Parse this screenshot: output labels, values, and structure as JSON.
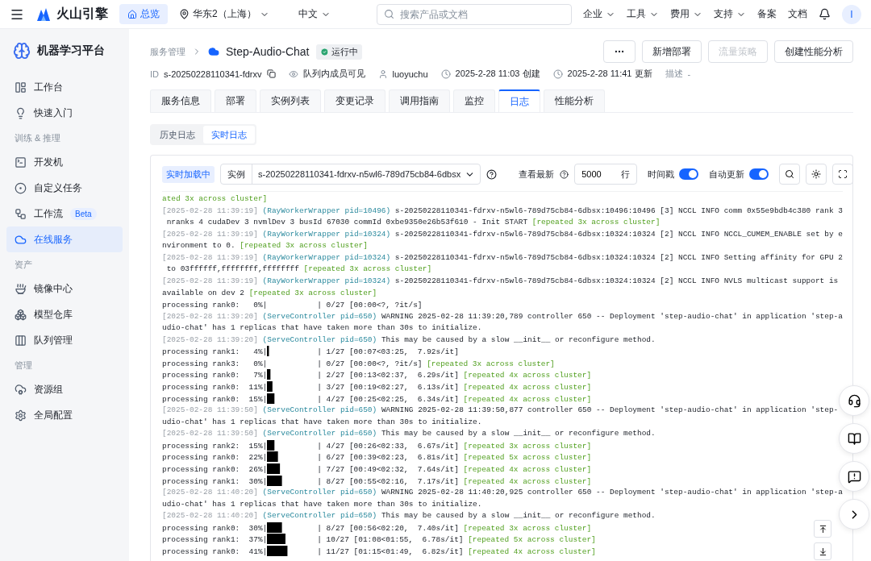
{
  "topbar": {
    "brand": "火山引擎",
    "home": "总览",
    "region": "华东2（上海）",
    "language": "中文",
    "search": {
      "placeholder": "搜索产品或文档"
    },
    "menus": [
      {
        "label": "企业",
        "dropdown": true
      },
      {
        "label": "工具",
        "dropdown": true
      },
      {
        "label": "费用",
        "dropdown": true
      },
      {
        "label": "支持",
        "dropdown": true
      },
      {
        "label": "备案",
        "dropdown": false
      },
      {
        "label": "文档",
        "dropdown": false
      }
    ],
    "avatar": "I"
  },
  "sidebar": {
    "title": "机器学习平台",
    "sections": [
      {
        "items": [
          {
            "label": "工作台",
            "selected": false
          },
          {
            "label": "快速入门",
            "selected": false
          }
        ]
      },
      {
        "heading": "训练 & 推理",
        "items": [
          {
            "label": "开发机",
            "selected": false
          },
          {
            "label": "自定义任务",
            "selected": false
          },
          {
            "label": "工作流",
            "badge": "Beta",
            "selected": false
          },
          {
            "label": "在线服务",
            "selected": true
          }
        ]
      },
      {
        "heading": "资产",
        "items": [
          {
            "label": "镜像中心",
            "selected": false
          },
          {
            "label": "模型仓库",
            "selected": false
          },
          {
            "label": "队列管理",
            "selected": false
          }
        ]
      },
      {
        "heading": "管理",
        "items": [
          {
            "label": "资源组",
            "selected": false
          },
          {
            "label": "全局配置",
            "selected": false
          }
        ]
      }
    ]
  },
  "service": {
    "breadcrumb": "服务管理",
    "name": "Step-Audio-Chat",
    "status": "运行中",
    "actions": [
      {
        "label": "新增部署",
        "disabled": false
      },
      {
        "label": "流量策略",
        "disabled": true
      },
      {
        "label": "创建性能分析",
        "disabled": false
      }
    ],
    "meta": {
      "id_label": "ID",
      "id": "s-20250228110341-fdrxv",
      "visibility": "队列内成员可见",
      "owner": "luoyuchu",
      "created": "2025-2-28 11:03 创建",
      "updated": "2025-2-28 11:41 更新",
      "description_label": "描述",
      "description": "-"
    }
  },
  "tabs": [
    {
      "label": "服务信息",
      "selected": false
    },
    {
      "label": "部署",
      "selected": false
    },
    {
      "label": "实例列表",
      "selected": false
    },
    {
      "label": "变更记录",
      "selected": false
    },
    {
      "label": "调用指南",
      "selected": false
    },
    {
      "label": "监控",
      "selected": false
    },
    {
      "label": "日志",
      "selected": true
    },
    {
      "label": "性能分析",
      "selected": false
    }
  ],
  "log_tabs": [
    {
      "label": "历史日志",
      "selected": false
    },
    {
      "label": "实时日志",
      "selected": true
    }
  ],
  "log_toolbar": {
    "status": "实时加载中",
    "instance_label": "实例",
    "instance": "s-20250228110341-fdrxv-n5wl6-789d75cb84-6dbsx",
    "latest_label": "查看最新",
    "line_count": "5000",
    "line_unit": "行",
    "toggles": [
      {
        "label": "时间戳",
        "on": true
      },
      {
        "label": "自动更新",
        "on": true
      }
    ]
  },
  "log_lines": [
    {
      "kind": "text",
      "repeat": "ated 3x across cluster]"
    },
    {
      "kind": "text",
      "time": "[2025-02-28 11:39:19]",
      "source": "(RayWorkerWrapper pid=10496)",
      "text": "s-20250228110341-fdrxv-n5wl6-789d75cb84-6dbsx:10496:10496 [3] NCCL INFO comm 0x55e9bdb4c380 rank 3"
    },
    {
      "kind": "text",
      "text": " nranks 4 cudaDev 3 nvmlDev 3 busId 67030 commId 0xbe9350e26b53f610 - Init START",
      "repeat": "[repeated 3x across cluster]"
    },
    {
      "kind": "text",
      "time": "[2025-02-28 11:39:19]",
      "source": "(RayWorkerWrapper pid=10324)",
      "text": "s-20250228110341-fdrxv-n5wl6-789d75cb84-6dbsx:10324:10324 [2] NCCL INFO NCCL_CUMEM_ENABLE set by e"
    },
    {
      "kind": "text",
      "text": "nvironment to 0.",
      "repeat": "[repeated 3x across cluster]"
    },
    {
      "kind": "text",
      "time": "[2025-02-28 11:39:19]",
      "source": "(RayWorkerWrapper pid=10324)",
      "text": "s-20250228110341-fdrxv-n5wl6-789d75cb84-6dbsx:10324:10324 [2] NCCL INFO Setting affinity for GPU 2"
    },
    {
      "kind": "text",
      "text": " to 03ffffff,ffffffff,ffffffff",
      "repeat": "[repeated 3x across cluster]"
    },
    {
      "kind": "text",
      "time": "[2025-02-28 11:39:19]",
      "source": "(RayWorkerWrapper pid=10324)",
      "text": "s-20250228110341-fdrxv-n5wl6-789d75cb84-6dbsx:10324:10324 [2] NCCL INFO NVLS multicast support is"
    },
    {
      "kind": "text",
      "text": "available on dev 2",
      "repeat": "[repeated 3x across cluster]"
    },
    {
      "kind": "progress",
      "label": "processing rank0:   0%|",
      "rest": "| 0/27 [00:00<?, ?it/s]"
    },
    {
      "kind": "text",
      "time": "[2025-02-28 11:39:20]",
      "source": "(ServeController pid=650)",
      "text": "WARNING 2025-02-28 11:39:20,789 controller 650 -- Deployment 'step-audio-chat' in application 'step-a"
    },
    {
      "kind": "text",
      "text": "udio-chat' has 1 replicas that have taken more than 30s to initialize."
    },
    {
      "kind": "text",
      "time": "[2025-02-28 11:39:20]",
      "source": "(ServeController pid=650)",
      "text": "This may be caused by a slow __init__ or reconfigure method."
    },
    {
      "kind": "progress",
      "label": "processing rank1:   4%|",
      "level": 0.04,
      "rest": "| 1/27 [00:07<03:25,  7.92s/it]"
    },
    {
      "kind": "progress",
      "label": "processing rank3:   0%|",
      "rest": "| 0/27 [00:00<?, ?it/s]",
      "repeat": "[repeated 3x across cluster]"
    },
    {
      "kind": "progress",
      "label": "processing rank0:   7%|",
      "level": 0.07,
      "rest": "| 2/27 [00:13<02:37,  6.29s/it]",
      "repeat": "[repeated 4x across cluster]"
    },
    {
      "kind": "progress",
      "label": "processing rank0:  11%|",
      "level": 0.11,
      "rest": "| 3/27 [00:19<02:27,  6.13s/it]",
      "repeat": "[repeated 4x across cluster]"
    },
    {
      "kind": "progress",
      "label": "processing rank0:  15%|",
      "level": 0.15,
      "rest": "| 4/27 [00:25<02:25,  6.34s/it]",
      "repeat": "[repeated 4x across cluster]"
    },
    {
      "kind": "text",
      "time": "[2025-02-28 11:39:50]",
      "source": "(ServeController pid=650)",
      "text": "WARNING 2025-02-28 11:39:50,877 controller 650 -- Deployment 'step-audio-chat' in application 'step-"
    },
    {
      "kind": "text",
      "text": "udio-chat' has 1 replicas that have taken more than 30s to initialize."
    },
    {
      "kind": "text",
      "time": "[2025-02-28 11:39:50]",
      "source": "(ServeController pid=650)",
      "text": "This may be caused by a slow __init__ or reconfigure method."
    },
    {
      "kind": "progress",
      "label": "processing rank2:  15%|",
      "level": 0.15,
      "rest": "| 4/27 [00:26<02:33,  6.67s/it]",
      "repeat": "[repeated 3x across cluster]"
    },
    {
      "kind": "progress",
      "label": "processing rank0:  22%|",
      "level": 0.22,
      "rest": "| 6/27 [00:39<02:23,  6.81s/it]",
      "repeat": "[repeated 5x across cluster]"
    },
    {
      "kind": "progress",
      "label": "processing rank0:  26%|",
      "level": 0.26,
      "rest": "| 7/27 [00:49<02:32,  7.64s/it]",
      "repeat": "[repeated 4x across cluster]"
    },
    {
      "kind": "progress",
      "label": "processing rank1:  30%|",
      "level": 0.3,
      "rest": "| 8/27 [00:55<02:16,  7.17s/it]",
      "repeat": "[repeated 4x across cluster]"
    },
    {
      "kind": "text",
      "time": "[2025-02-28 11:40:20]",
      "source": "(ServeController pid=650)",
      "text": "WARNING 2025-02-28 11:40:20,925 controller 650 -- Deployment 'step-audio-chat' in application 'step-a"
    },
    {
      "kind": "text",
      "text": "udio-chat' has 1 replicas that have taken more than 30s to initialize."
    },
    {
      "kind": "text",
      "time": "[2025-02-28 11:40:20]",
      "source": "(ServeController pid=650)",
      "text": "This may be caused by a slow __init__ or reconfigure method."
    },
    {
      "kind": "progress",
      "label": "processing rank0:  30%|",
      "level": 0.3,
      "rest": "| 8/27 [00:56<02:20,  7.40s/it]",
      "repeat": "[repeated 3x across cluster]"
    },
    {
      "kind": "progress",
      "label": "processing rank1:  37%|",
      "level": 0.37,
      "rest": "| 10/27 [01:08<01:55,  6.78s/it]",
      "repeat": "[repeated 5x across cluster]"
    },
    {
      "kind": "progress",
      "label": "processing rank0:  41%|",
      "level": 0.41,
      "rest": "| 11/27 [01:15<01:49,  6.82s/it]",
      "repeat": "[repeated 4x across cluster]"
    }
  ]
}
